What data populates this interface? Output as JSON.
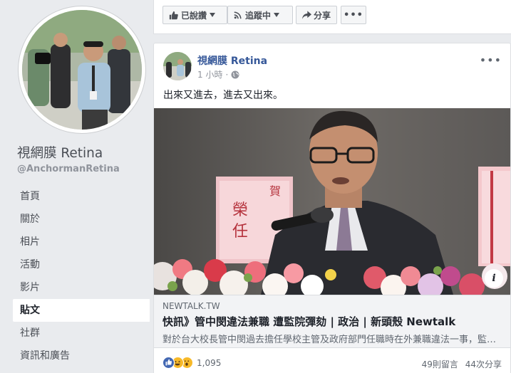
{
  "page": {
    "name": "視網膜 Retina",
    "handle": "@AnchormanRetina"
  },
  "nav": {
    "items": [
      "首頁",
      "關於",
      "相片",
      "活動",
      "影片",
      "貼文",
      "社群",
      "資訊和廣告"
    ],
    "active_index": 5
  },
  "actions": {
    "liked_label": "已說讚",
    "following_label": "追蹤中",
    "share_label": "分享",
    "more_icon": "ellipsis-icon"
  },
  "post": {
    "author": "視網膜 Retina",
    "time": "1 小時",
    "privacy_icon": "globe-icon",
    "text": "出來又進去，進去又出來。",
    "link": {
      "domain": "NEWTALK.TW",
      "headline": "快訊》管中閔違法兼職 遭監院彈劾 | 政治 | 新頭殼 Newtalk",
      "description": "對於台大校長管中閔過去擔任學校主管及政府部門任職時在外兼職違法一事，監察院今天通過彈劾案。"
    },
    "reactions": {
      "count": "1,095",
      "types": [
        "like",
        "haha",
        "wow"
      ]
    },
    "comments": "49則留言",
    "shares": "44次分享"
  },
  "colors": {
    "brand": "#4267b2",
    "link_blue": "#365899",
    "haha_yellow": "#f7b928"
  }
}
